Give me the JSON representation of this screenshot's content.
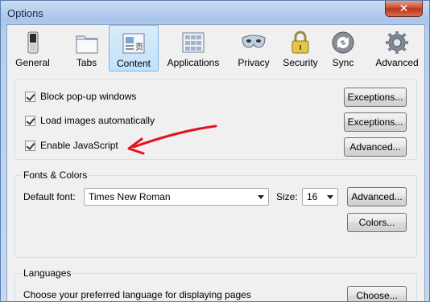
{
  "window": {
    "title": "Options",
    "close_glyph": "✕"
  },
  "tabs": [
    {
      "label": "General",
      "icon": "switch-icon"
    },
    {
      "label": "Tabs",
      "icon": "tabs-icon"
    },
    {
      "label": "Content",
      "icon": "content-icon",
      "selected": true
    },
    {
      "label": "Applications",
      "icon": "applications-icon"
    },
    {
      "label": "Privacy",
      "icon": "mask-icon"
    },
    {
      "label": "Security",
      "icon": "lock-icon"
    },
    {
      "label": "Sync",
      "icon": "sync-icon"
    },
    {
      "label": "Advanced",
      "icon": "gear-icon"
    }
  ],
  "content": {
    "block_popups": {
      "label": "Block pop-up windows",
      "checked": true
    },
    "load_images": {
      "label": "Load images automatically",
      "checked": true
    },
    "enable_js": {
      "label": "Enable JavaScript",
      "checked": true
    },
    "exceptions_label": "Exceptions...",
    "advanced_label": "Advanced..."
  },
  "fonts": {
    "legend": "Fonts & Colors",
    "default_font_label": "Default font:",
    "default_font_value": "Times New Roman",
    "size_label": "Size:",
    "size_value": "16",
    "advanced_label": "Advanced...",
    "colors_label": "Colors..."
  },
  "languages": {
    "legend": "Languages",
    "description": "Choose your preferred language for displaying pages",
    "choose_label": "Choose..."
  },
  "colors": {
    "accent": "#3a6ea5",
    "annotation_red": "#e0141e"
  }
}
